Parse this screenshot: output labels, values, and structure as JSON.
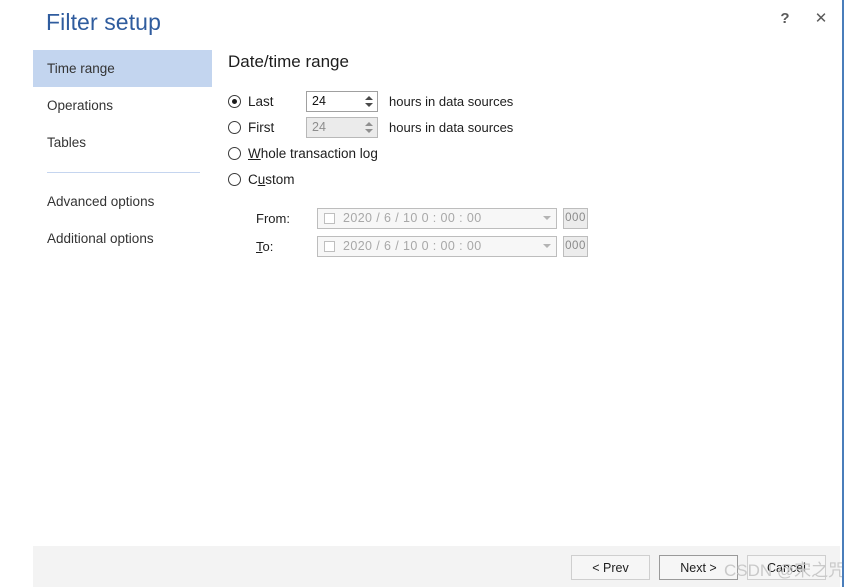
{
  "window": {
    "title": "Filter setup",
    "help_icon": "question-mark-icon",
    "close_icon": "close-icon"
  },
  "sidebar": {
    "items": [
      {
        "label": "Time range",
        "selected": true
      },
      {
        "label": "Operations",
        "selected": false
      },
      {
        "label": "Tables",
        "selected": false
      }
    ],
    "items_secondary": [
      {
        "label": "Advanced options",
        "selected": false
      },
      {
        "label": "Additional options",
        "selected": false
      }
    ]
  },
  "main": {
    "heading": "Date/time range",
    "options": [
      {
        "id": "last",
        "label": "Last",
        "accelerator": "",
        "checked": true,
        "spinner": {
          "value": "24",
          "disabled": false
        },
        "suffix": "hours in data sources"
      },
      {
        "id": "first",
        "label": "First",
        "accelerator": "",
        "checked": false,
        "spinner": {
          "value": "24",
          "disabled": true
        },
        "suffix": "hours in data sources"
      }
    ],
    "option_whole": {
      "id": "whole-transaction-log",
      "label_accel": "W",
      "label_rest": "hole transaction log",
      "checked": false
    },
    "option_custom": {
      "id": "custom",
      "label_pre": "C",
      "label_accel": "u",
      "label_rest": "stom",
      "checked": false
    },
    "custom": {
      "from": {
        "label": "From:",
        "checkbox_checked": false,
        "value": "2020 /  6 / 10      0 : 00 : 00",
        "dropdown_icon": "chevron-down-icon",
        "ms_button": "000"
      },
      "to": {
        "label_accel": "T",
        "label_rest": "o:",
        "checkbox_checked": false,
        "value": "2020 /  6 / 10      0 : 00 : 00",
        "dropdown_icon": "chevron-down-icon",
        "ms_button": "000"
      }
    }
  },
  "footer": {
    "prev_label": "< Prev",
    "next_label": "Next >",
    "cancel_label": "Cancel"
  },
  "watermark": {
    "text": "CSDN @宋之咒"
  },
  "colors": {
    "title": "#2f5c9e",
    "sidebar_selected": "#c3d5ef",
    "divider": "#c5d5ef",
    "footer_bg": "#f3f3f3",
    "window_border": "#4a7ebb"
  }
}
